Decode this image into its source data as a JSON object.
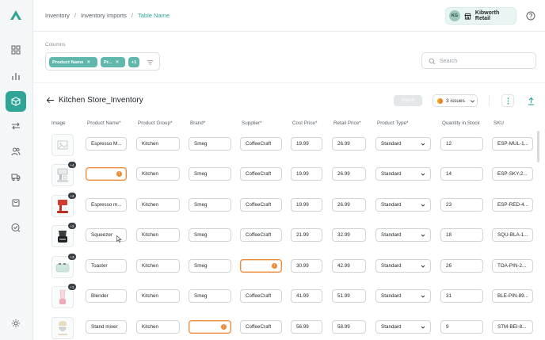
{
  "nav": {
    "items": [
      {
        "name": "dashboard",
        "icon": "grid-icon",
        "active": false
      },
      {
        "name": "analytics",
        "icon": "bar-chart-icon",
        "active": false
      },
      {
        "name": "inventory",
        "icon": "box-icon",
        "active": true
      },
      {
        "name": "transfers",
        "icon": "arrows-swap-icon",
        "active": false
      },
      {
        "name": "users",
        "icon": "users-icon",
        "active": false
      },
      {
        "name": "shipping",
        "icon": "truck-icon",
        "active": false
      },
      {
        "name": "orders",
        "icon": "shopping-bag-icon",
        "active": false
      },
      {
        "name": "tasks",
        "icon": "checklist-icon",
        "active": false
      },
      {
        "name": "settings",
        "icon": "gear-icon",
        "active": false
      }
    ]
  },
  "breadcrumb": {
    "items": [
      "Inventory",
      "Inventory Imports",
      "Table Name"
    ],
    "separator": "/"
  },
  "account": {
    "initials": "KG",
    "name": "Kibworth Retail"
  },
  "columns": {
    "label": "Columns",
    "chips": [
      "Product Name",
      "Pr...",
      "+1"
    ]
  },
  "search": {
    "placeholder": "Search",
    "value": ""
  },
  "page": {
    "title": "Kitchen Store_Inventory",
    "import_label": "Import",
    "issues_label": "3 issues"
  },
  "table": {
    "headers": [
      "Image",
      "Product Name*",
      "Product Group*",
      "Brand*",
      "Supplier*",
      "Cost Price*",
      "Retail Price*",
      "Product Type*",
      "Quantity in Stock",
      "SKU"
    ],
    "rows": [
      {
        "image_badge": "",
        "name": "Espresso M...",
        "group": "Kitchen",
        "brand": "Smeg",
        "supplier": "CoffeeCraft",
        "cost": "19.99",
        "retail": "26.99",
        "type": "Standard",
        "qty": "12",
        "sku": "ESP-MUL-1..."
      },
      {
        "image_badge": "+4",
        "name": "",
        "group": "Kitchen",
        "brand": "Smeg",
        "supplier": "CoffeeCraft",
        "cost": "19.99",
        "retail": "26.99",
        "type": "Standard",
        "qty": "14",
        "sku": "ESP-SKY-2..."
      },
      {
        "image_badge": "+4",
        "name": "Espresso m...",
        "group": "Kitchen",
        "brand": "Smeg",
        "supplier": "CoffeeCraft",
        "cost": "19.99",
        "retail": "26.99",
        "type": "Standard",
        "qty": "23",
        "sku": "ESP-RED-4..."
      },
      {
        "image_badge": "+2",
        "name": "Squeezer",
        "group": "Kitchen",
        "brand": "Smeg",
        "supplier": "CoffeeCraft",
        "cost": "21.99",
        "retail": "32.99",
        "type": "Standard",
        "qty": "18",
        "sku": "SQU-BLA-1..."
      },
      {
        "image_badge": "+3",
        "name": "Toaster",
        "group": "Kitchen",
        "brand": "Smeg",
        "supplier": "",
        "cost": "30.99",
        "retail": "42.99",
        "type": "Standard",
        "qty": "26",
        "sku": "TOA-PIN-2..."
      },
      {
        "image_badge": "+1",
        "name": "Blender",
        "group": "Kitchen",
        "brand": "Smeg",
        "supplier": "CoffeeCraft",
        "cost": "41.99",
        "retail": "51.99",
        "type": "Standard",
        "qty": "31",
        "sku": "BLE-PIN-89..."
      },
      {
        "image_badge": "",
        "name": "Stand mixer",
        "group": "Kitchen",
        "brand": "",
        "supplier": "CoffeeCraft",
        "cost": "56.99",
        "retail": "58.99",
        "type": "Standard",
        "qty": "9",
        "sku": "STM-BEI-8..."
      }
    ]
  },
  "colors": {
    "accent": "#2ea597",
    "warning": "#ee8a34",
    "chip": "#5fb8ab"
  }
}
